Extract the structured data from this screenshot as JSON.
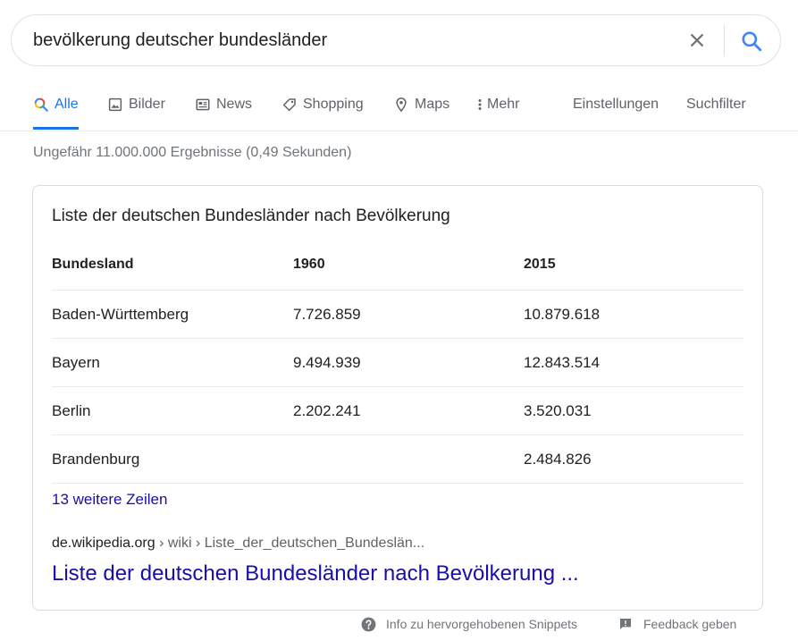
{
  "search": {
    "query": "bevölkerung deutscher bundesländer",
    "clear_icon": "close-icon",
    "search_icon": "search-icon"
  },
  "tabs": [
    {
      "label": "Alle",
      "icon": "search-multicolor-icon",
      "active": true
    },
    {
      "label": "Bilder",
      "icon": "image-icon"
    },
    {
      "label": "News",
      "icon": "newspaper-icon"
    },
    {
      "label": "Shopping",
      "icon": "tag-icon"
    },
    {
      "label": "Maps",
      "icon": "map-pin-icon"
    },
    {
      "label": "Mehr",
      "icon": "more-vert-icon"
    }
  ],
  "tools": {
    "settings": "Einstellungen",
    "filters": "Suchfilter"
  },
  "stats": "Ungefähr 11.000.000 Ergebnisse (0,49 Sekunden)",
  "snippet": {
    "title": "Liste der deutschen Bundesländer nach Bevölkerung",
    "table": {
      "headers": [
        "Bundesland",
        "1960",
        "2015"
      ],
      "rows": [
        [
          "Baden-Württemberg",
          "7.726.859",
          "10.879.618"
        ],
        [
          "Bayern",
          "9.494.939",
          "12.843.514"
        ],
        [
          "Berlin",
          "2.202.241",
          "3.520.031"
        ],
        [
          "Brandenburg",
          "",
          "2.484.826"
        ]
      ]
    },
    "more_rows": "13 weitere Zeilen",
    "breadcrumb_host": "de.wikipedia.org",
    "breadcrumb_path": " › wiki › Liste_der_deutschen_Bundeslän...",
    "link_title": "Liste der deutschen Bundesländer nach Bevölkerung ..."
  },
  "footer": {
    "info": "Info zu hervorgehobenen Snippets",
    "feedback": "Feedback geben"
  },
  "colors": {
    "accent": "#1a73e8",
    "link": "#1a0dab",
    "muted": "#70757a"
  }
}
